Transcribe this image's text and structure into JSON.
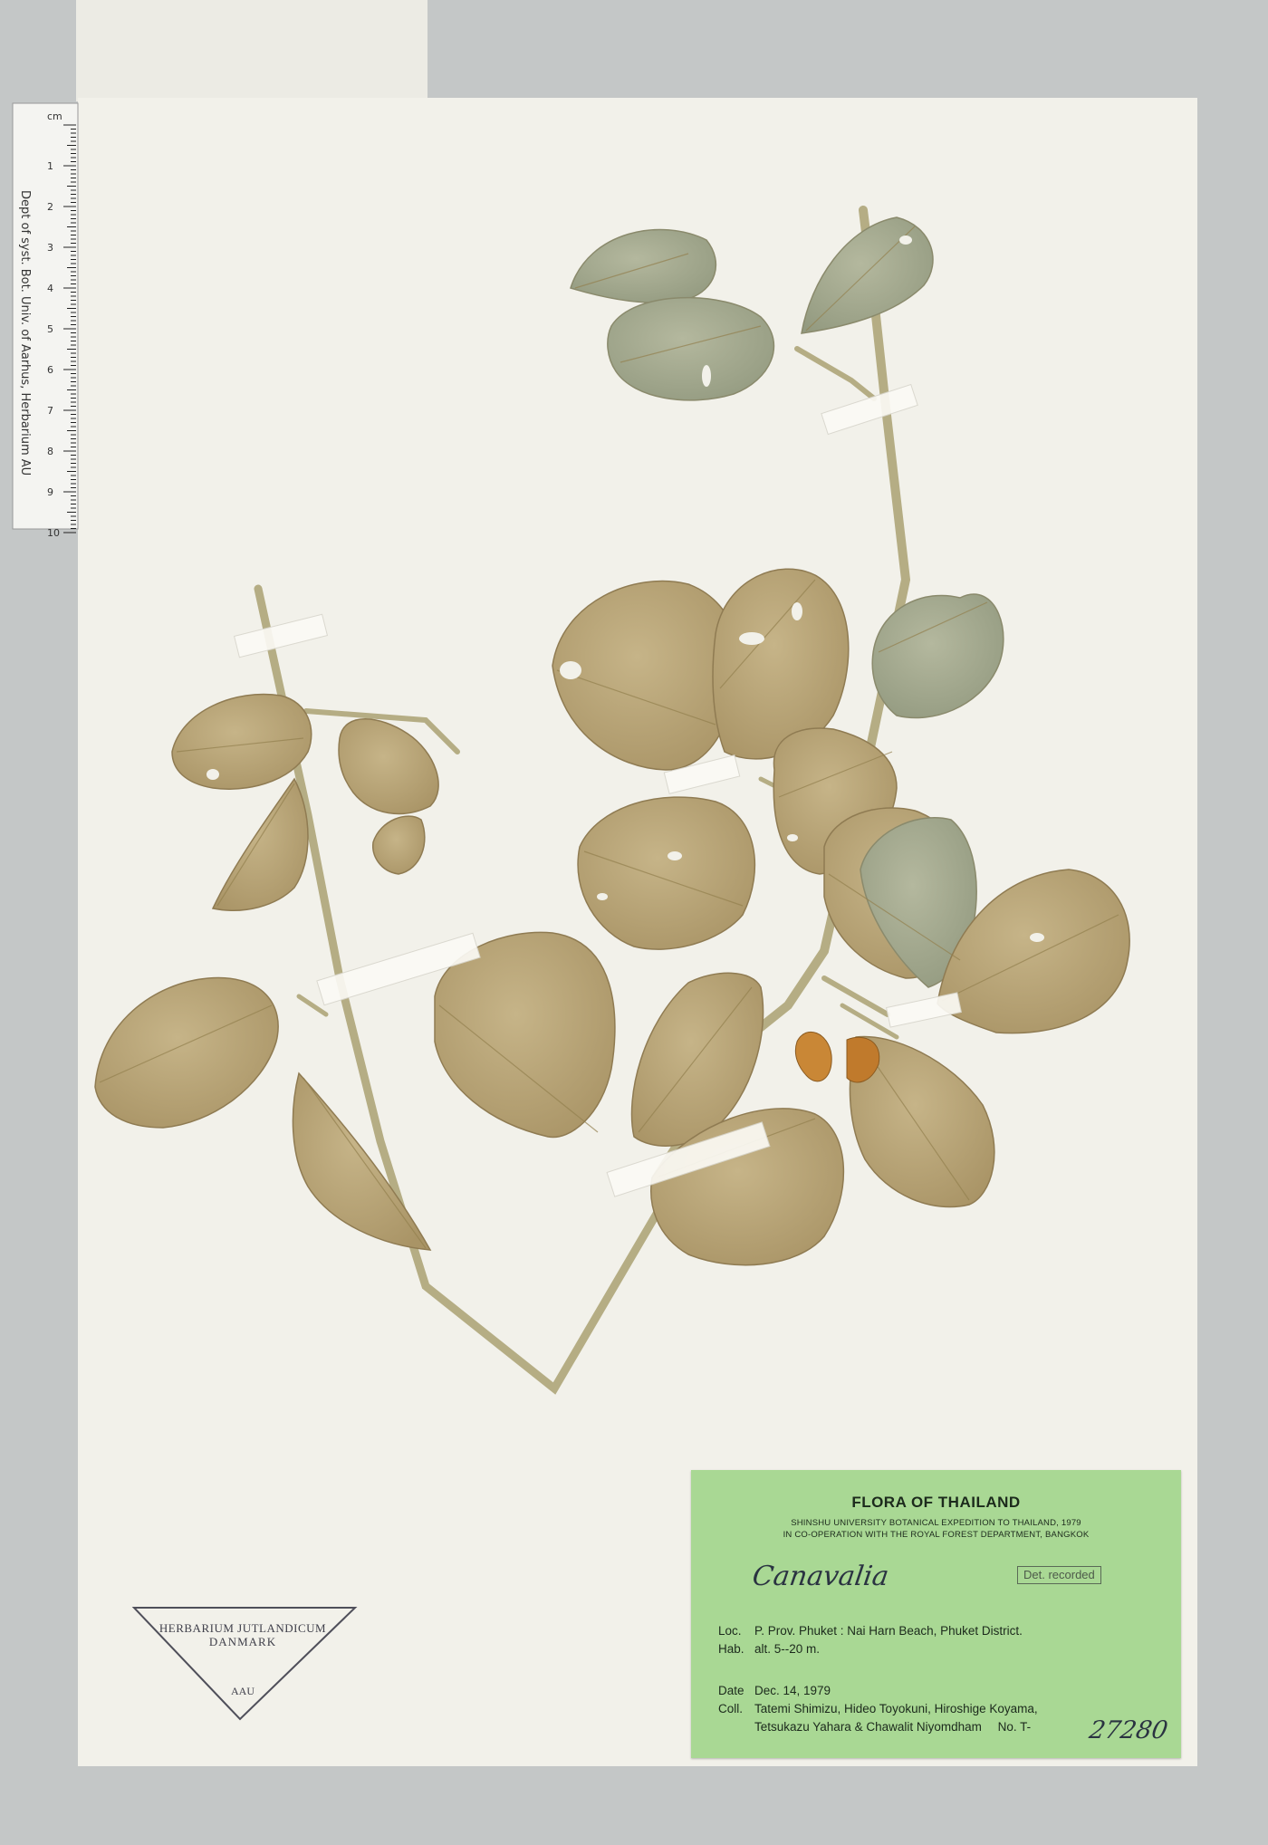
{
  "label": {
    "title": "FLORA OF THAILAND",
    "subtitle_1": "SHINSHU UNIVERSITY BOTANICAL EXPEDITION TO THAILAND, 1979",
    "subtitle_2": "IN CO-OPERATION WITH THE ROYAL FOREST DEPARTMENT, BANGKOK",
    "det_stamp": "Det. recorded",
    "determination": "Canavalia",
    "loc_key": "Loc.",
    "loc_value": "P. Prov. Phuket : Nai Harn Beach, Phuket District.",
    "hab_key": "Hab.",
    "hab_value": "alt. 5--20 m.",
    "date_key": "Date",
    "date_value": "Dec. 14, 1979",
    "coll_key": "Coll.",
    "coll_value_1": "Tatemi Shimizu, Hideo Toyokuni, Hiroshige Koyama,",
    "coll_value_2": "Tetsukazu Yahara & Chawalit Niyomdham",
    "number_prefix": "No. T-",
    "number_handwritten": "27280"
  },
  "herbarium_stamp": {
    "line_1": "HERBARIUM JUTLANDICUM",
    "line_2": "DANMARK",
    "code": "AAU"
  },
  "ruler": {
    "unit": "cm",
    "ticks": [
      "1",
      "2",
      "3",
      "4",
      "5",
      "6",
      "7",
      "8",
      "9",
      "10"
    ],
    "side_text": "Dept of syst. Bot. Univ. of Aarhus, Herbarium AU"
  },
  "colors": {
    "background": "#c4c7c7",
    "sheet": "#f2f1ea",
    "label": "#a9d894",
    "leaf": "#bba77a",
    "leaf_green": "#a7ad92",
    "stem": "#b5ad84",
    "flower": "#c98736"
  }
}
